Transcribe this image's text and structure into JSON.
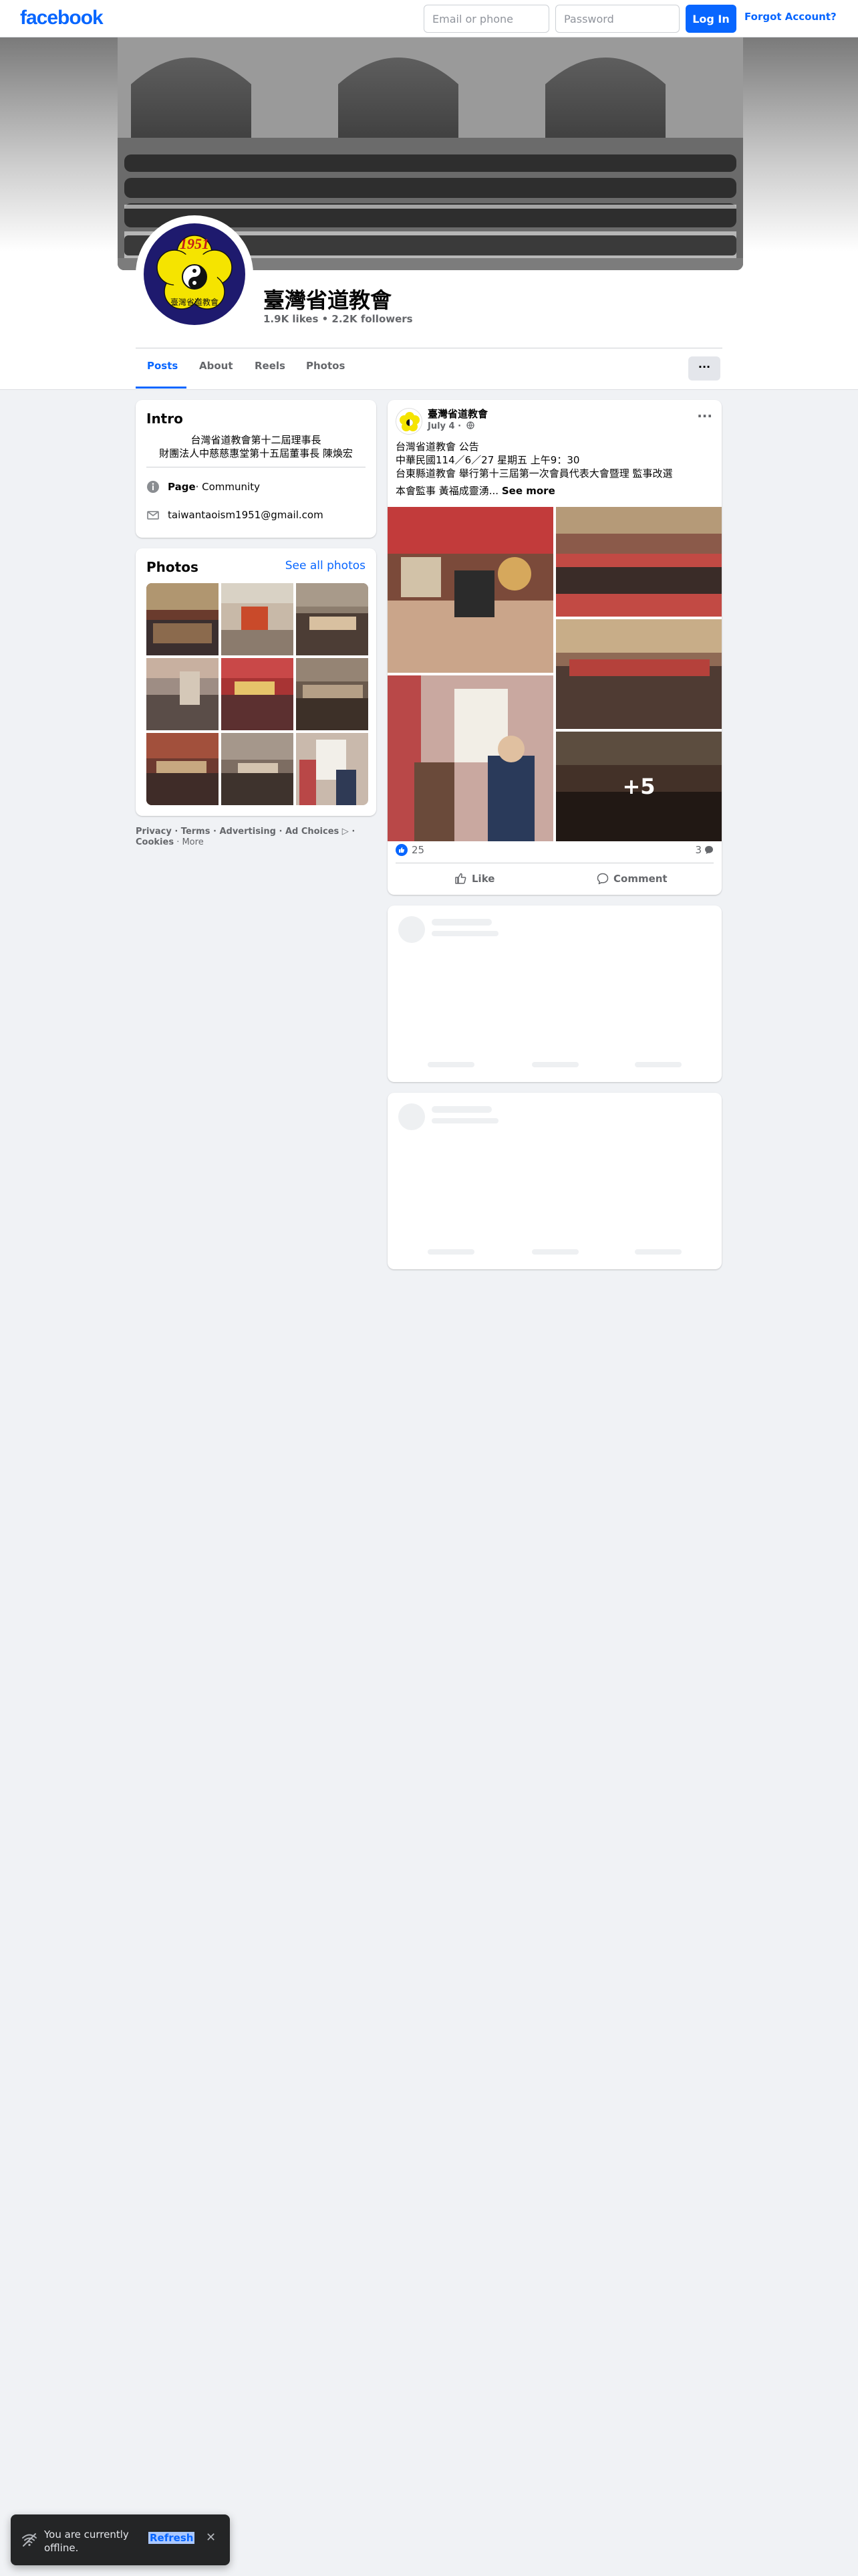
{
  "topbar": {
    "logo": "facebook",
    "email_placeholder": "Email or phone",
    "password_placeholder": "Password",
    "login_label": "Log In",
    "forgot_label": "Forgot Account?"
  },
  "profile": {
    "name": "臺灣省道教會",
    "stats": "1.9K likes • 2.2K followers",
    "avatar_year": "1951",
    "avatar_text": "臺灣省道教會"
  },
  "tabs": [
    {
      "label": "Posts",
      "active": true
    },
    {
      "label": "About"
    },
    {
      "label": "Reels"
    },
    {
      "label": "Photos"
    }
  ],
  "more_label": "···",
  "intro": {
    "title": "Intro",
    "desc_line1": "台灣省道教會第十二屆理事長",
    "desc_line2": "財團法人中慈慈惠堂第十五屆董事長 陳煥宏",
    "page_label": "Page",
    "page_category": " · Community",
    "email": "taiwantaoism1951@gmail.com"
  },
  "photos": {
    "title": "Photos",
    "see_all": "See all photos"
  },
  "footer": {
    "line1": "Privacy · Terms · Advertising · Ad Choices ▷ ·",
    "cookies": "Cookies",
    "more": " · More"
  },
  "post": {
    "author": "臺灣省道教會",
    "date": "July 4 ·",
    "menu": "···",
    "line1": "台灣省道教會 公告",
    "line2": "中華民國114／6／27 星期五 上午9：30",
    "line3": "台東縣道教會 舉行第十三屆第一次會員代表大會暨理 監事改選",
    "line4": "本會監事 黃福成靈湧...",
    "see_more": "See more",
    "more_photos": "+5",
    "like_count": "25",
    "comment_count": "3",
    "like_label": "Like",
    "comment_label": "Comment"
  },
  "toast": {
    "message": "You are currently offline.",
    "refresh": "Refresh",
    "close": "✕"
  }
}
